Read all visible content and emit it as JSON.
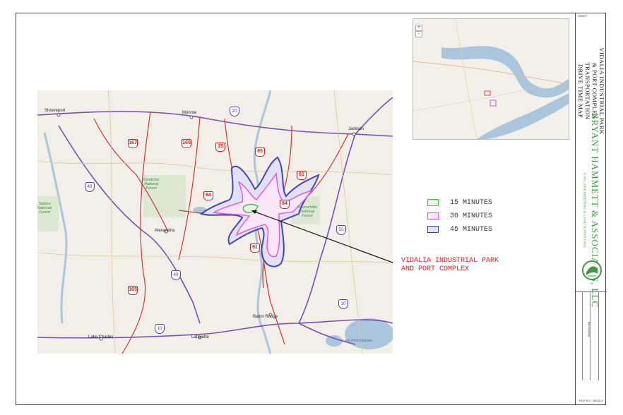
{
  "legend": {
    "items": [
      {
        "label": "15 MINUTES",
        "color": "#3cc43c",
        "fill": "#e8f7e8"
      },
      {
        "label": "30 MINUTES",
        "color": "#e15ad8",
        "fill": "#fbe6f8"
      },
      {
        "label": "45 MINUTES",
        "color": "#3b3bb3",
        "fill": "#e2e2f7"
      }
    ]
  },
  "callout": {
    "line1": "VIDALIA INDUSTRIAL PARK",
    "line2": "AND PORT COMPLEX",
    "color": "#e8141b"
  },
  "map": {
    "cities": {
      "shreveport": "Shreveport",
      "monroe": "Monroe",
      "jackson": "Jackson",
      "alexandria": "Alexandria",
      "baton_rouge": "Baton Rouge",
      "lake_charles": "Lake Charles",
      "lafayette": "Lafayette",
      "lake_pontchartrain": "Lake Pontchartrain"
    },
    "parks": {
      "kisatchie": "Kisatchie\nNational\nForest",
      "homochitto": "Homochitto\nNational\nForest",
      "sabine": "Sabine\nNational\nForest"
    },
    "us_routes": [
      "167",
      "165",
      "15",
      "65",
      "61",
      "84",
      "84",
      "61",
      "165"
    ],
    "interstates": [
      "20",
      "49",
      "55",
      "49",
      "10",
      "10"
    ]
  },
  "titleblock": {
    "sheet_label": "SHEET",
    "title_lines": [
      "VIDALIA INDUSTRIAL PARK",
      "& PORT COMPLEX",
      "TRANSPORTATION",
      "DRIVE TIME MAP"
    ],
    "company": "BRYANT HAMMETT & ASSOCIATES, LLC",
    "tagline": "CIVIL ENGINEERING & LAND SURVEYING",
    "revisions_label": "REVISIONS",
    "file_label": "FILE NO.: 18022-4",
    "brand_color": "#3e9a3e"
  },
  "inset": {
    "zoom_in": "+",
    "zoom_out": "−"
  }
}
